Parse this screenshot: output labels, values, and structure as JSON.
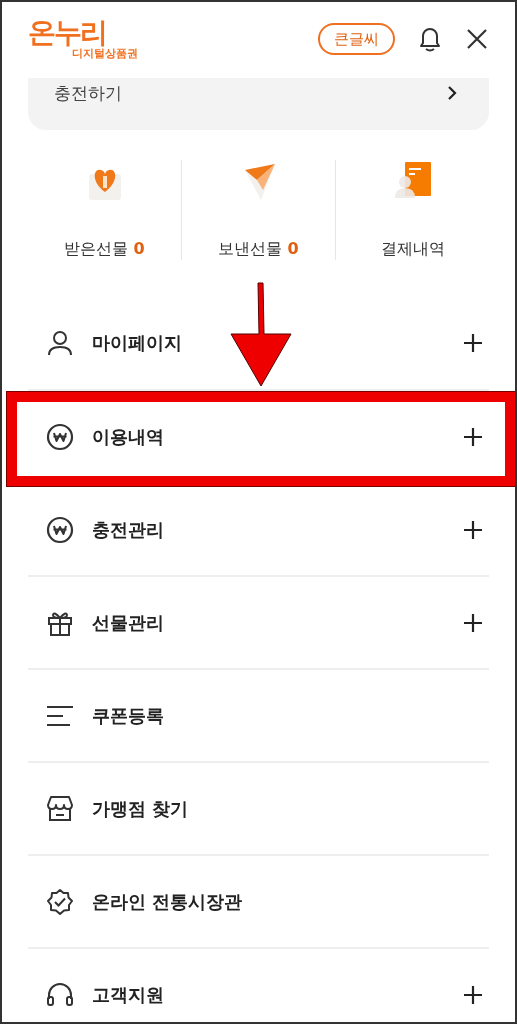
{
  "header": {
    "logo": {
      "title": "온누리",
      "subtitle": "디지털상품권"
    },
    "large_text_button": "큰글씨"
  },
  "charge_card": {
    "label": "충전하기"
  },
  "quick_links": [
    {
      "label": "받은선물",
      "count": "0"
    },
    {
      "label": "보낸선물",
      "count": "0"
    },
    {
      "label": "결제내역"
    }
  ],
  "menu": [
    {
      "label": "마이페이지",
      "expandable": true
    },
    {
      "label": "이용내역",
      "expandable": true
    },
    {
      "label": "충전관리",
      "expandable": true
    },
    {
      "label": "선물관리",
      "expandable": true
    },
    {
      "label": "쿠폰등록",
      "expandable": false
    },
    {
      "label": "가맹점 찾기",
      "expandable": false
    },
    {
      "label": "온라인 전통시장관",
      "expandable": false
    },
    {
      "label": "고객지원",
      "expandable": true
    }
  ]
}
